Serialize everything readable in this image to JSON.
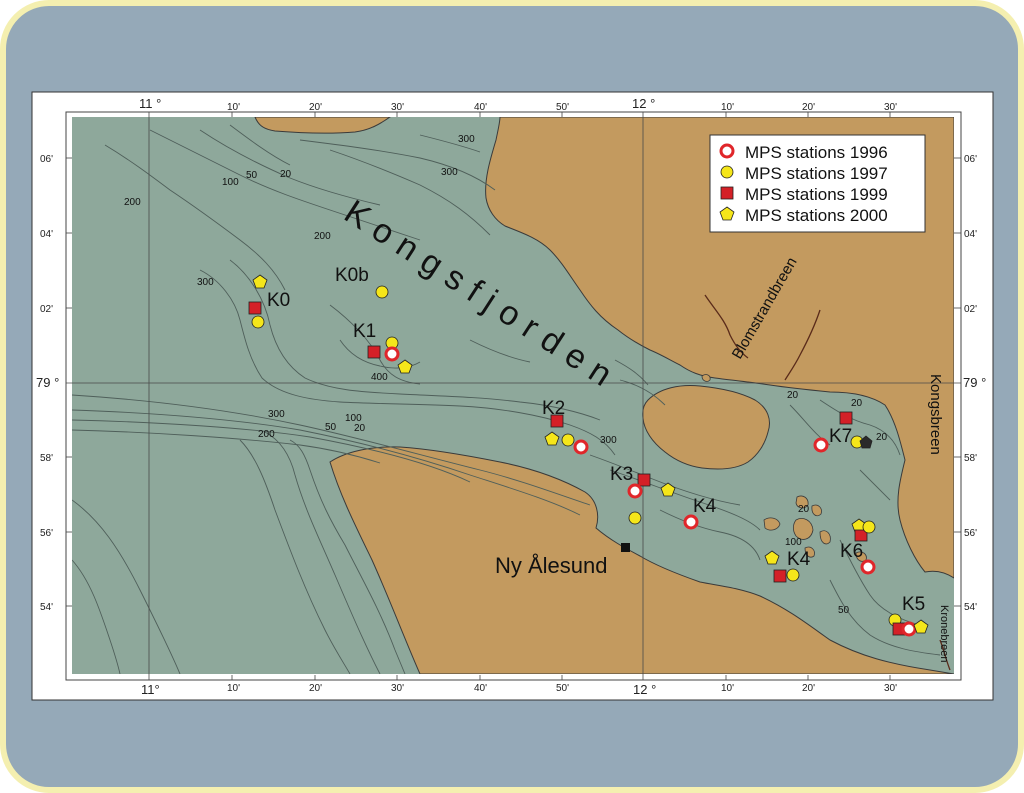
{
  "colors": {
    "outer_bg": "#95a9b8",
    "outer_border": "#f4efb0",
    "water": "#8ea89b",
    "land": "#c39a5f",
    "station_1996": "#e0262a",
    "station_1997": "#f5e61a",
    "station_1999": "#d42027",
    "station_2000": "#f5e61a"
  },
  "map": {
    "fjord_name": "Kongsfjorden",
    "settlement": "Ny Ålesund",
    "glaciers": [
      "Blomstrandbreen",
      "Kongsbreen",
      "Kronebreen"
    ],
    "lon_major": [
      "11 °",
      "12 °",
      "11°",
      "12 °"
    ],
    "lon_minor_top": [
      "10'",
      "20'",
      "30'",
      "40'",
      "50'",
      "10'",
      "20'",
      "30'"
    ],
    "lon_minor_bottom": [
      "10'",
      "20'",
      "30'",
      "40'",
      "50'",
      "10'",
      "20'",
      "30'"
    ],
    "lat_labels": [
      "06'",
      "04'",
      "02'",
      "79 °",
      "58'",
      "56'",
      "54'"
    ],
    "depth_labels": [
      "300",
      "300",
      "100",
      "50",
      "20",
      "200",
      "200",
      "300",
      "400",
      "300",
      "100",
      "50",
      "20",
      "200",
      "300",
      "20",
      "20",
      "20",
      "20",
      "100",
      "50"
    ]
  },
  "legend": {
    "items": [
      {
        "label": "MPS stations 1996",
        "marker": "ring"
      },
      {
        "label": "MPS stations 1997",
        "marker": "circle"
      },
      {
        "label": "MPS stations 1999",
        "marker": "square"
      },
      {
        "label": "MPS stations 2000",
        "marker": "pentagon"
      }
    ]
  },
  "stations": {
    "labels": [
      "K0",
      "K0b",
      "K1",
      "K2",
      "K3",
      "K4",
      "K4",
      "K5",
      "K6",
      "K7"
    ]
  }
}
